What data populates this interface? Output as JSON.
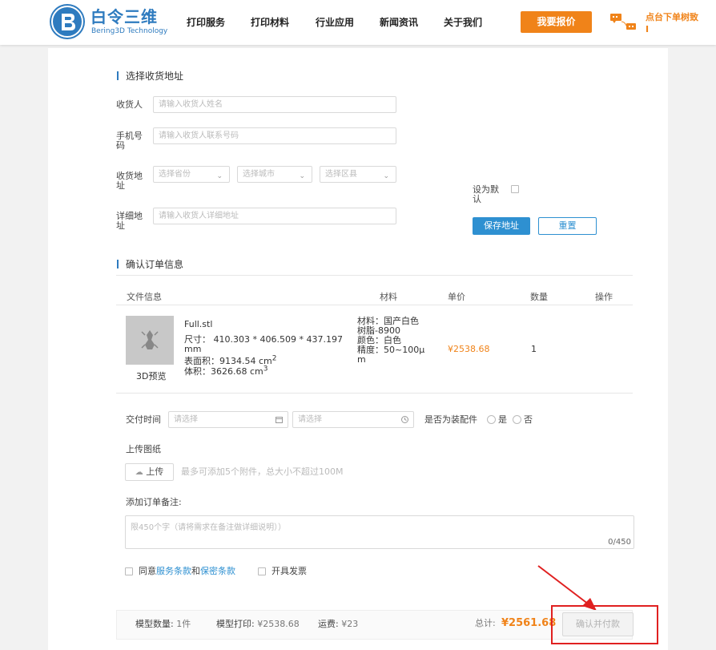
{
  "header": {
    "brand_cn": "白令三维",
    "brand_en": "Bering3D Technology",
    "nav": [
      "打印服务",
      "打印材料",
      "行业应用",
      "新闻资讯",
      "关于我们"
    ],
    "quote_button": "我要报价",
    "hot_text": "点台下单树致I",
    "brand_color": "#2e7bbf",
    "accent_color": "#f08319"
  },
  "address": {
    "section_title": "选择收货地址",
    "receiver_label": "收货人",
    "receiver_placeholder": "请输入收货人姓名",
    "phone_label_1": "手机号",
    "phone_label_2": "码",
    "phone_placeholder": "请输入收货人联系号码",
    "region_label_1": "收货地",
    "region_label_2": "址",
    "province_placeholder": "选择省份",
    "city_placeholder": "选择城市",
    "district_placeholder": "选择区县",
    "default_label_1": "设为默",
    "default_label_2": "认",
    "detail_label_1": "详细地",
    "detail_label_2": "址",
    "detail_placeholder": "请输入收货人详细地址",
    "save_button": "保存地址",
    "reset_button": "重置"
  },
  "order": {
    "section_title": "确认订单信息",
    "columns": [
      "文件信息",
      "材料",
      "单价",
      "数量",
      "操作"
    ],
    "item": {
      "preview_label": "3D预览",
      "file_name": "Full.stl",
      "size_line_1": "尺寸：  410.303 * 406.509 * 437.197",
      "size_line_2": "mm",
      "area": "表面积：9134.54 cm",
      "area_exp": "2",
      "volume": "体积：3626.68 cm",
      "volume_exp": "3",
      "material_1": "材料：国产白色",
      "material_2": "树脂-8900",
      "color": "颜色：白色",
      "precision_1": "精度：50~100μ",
      "precision_2": "m",
      "price": "¥2538.68",
      "quantity": "1"
    }
  },
  "delivery": {
    "label": "交付时间",
    "date_placeholder": "请选择",
    "time_placeholder": "请选择",
    "assembly_label": "是否为装配件",
    "yes": "是",
    "no": "否"
  },
  "upload": {
    "label": "上传图纸",
    "button": "上传",
    "hint": "最多可添加5个附件，总大小不超过100M"
  },
  "remark": {
    "label": "添加订单备注:",
    "placeholder": "限450个字（请将需求在备注做详细说明））",
    "counter": "0/450"
  },
  "agree": {
    "prefix": "同意",
    "service_terms": "服务条款",
    "and": "和",
    "privacy_terms": "保密条款",
    "invoice": "开具发票"
  },
  "footer": {
    "count_label": "模型数量:",
    "count_value": "1件",
    "print_label": "模型打印:",
    "print_value": "¥2538.68",
    "shipping_label": "运费:",
    "shipping_value": "¥23",
    "total_label": "总计:",
    "total_value": "¥2561.68",
    "pay_button": "确认并付款"
  }
}
